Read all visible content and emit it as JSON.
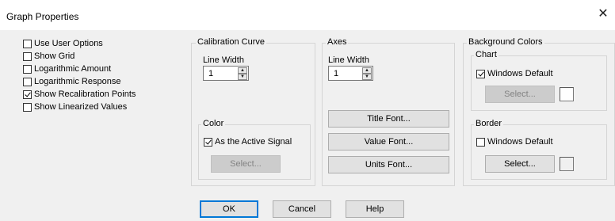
{
  "window": {
    "title": "Graph Properties",
    "close_glyph": "✕"
  },
  "options": [
    {
      "label": "Use User Options",
      "checked": false
    },
    {
      "label": "Show Grid",
      "checked": false
    },
    {
      "label": "Logarithmic Amount",
      "checked": false
    },
    {
      "label": "Logarithmic Response",
      "checked": false
    },
    {
      "label": "Show Recalibration Points",
      "checked": true
    },
    {
      "label": "Show Linearized Values",
      "checked": false
    }
  ],
  "calibration": {
    "title": "Calibration Curve",
    "line_width_label": "Line Width",
    "line_width": "1",
    "color": {
      "title": "Color",
      "active_signal_label": "As the Active Signal",
      "active_signal_checked": true,
      "select_label": "Select..."
    }
  },
  "axes": {
    "title": "Axes",
    "line_width_label": "Line Width",
    "line_width": "1",
    "title_font_label": "Title Font...",
    "value_font_label": "Value Font...",
    "units_font_label": "Units Font..."
  },
  "background": {
    "title": "Background Colors",
    "chart": {
      "title": "Chart",
      "windows_default_label": "Windows Default",
      "windows_default_checked": true,
      "select_label": "Select...",
      "swatch_color": "#ffffff"
    },
    "border": {
      "title": "Border",
      "windows_default_label": "Windows Default",
      "windows_default_checked": false,
      "select_label": "Select...",
      "swatch_color": "#f0f0f0"
    }
  },
  "footer": {
    "ok_label": "OK",
    "cancel_label": "Cancel",
    "help_label": "Help"
  },
  "icons": {
    "spin_up": "▲",
    "spin_down": "▼"
  }
}
